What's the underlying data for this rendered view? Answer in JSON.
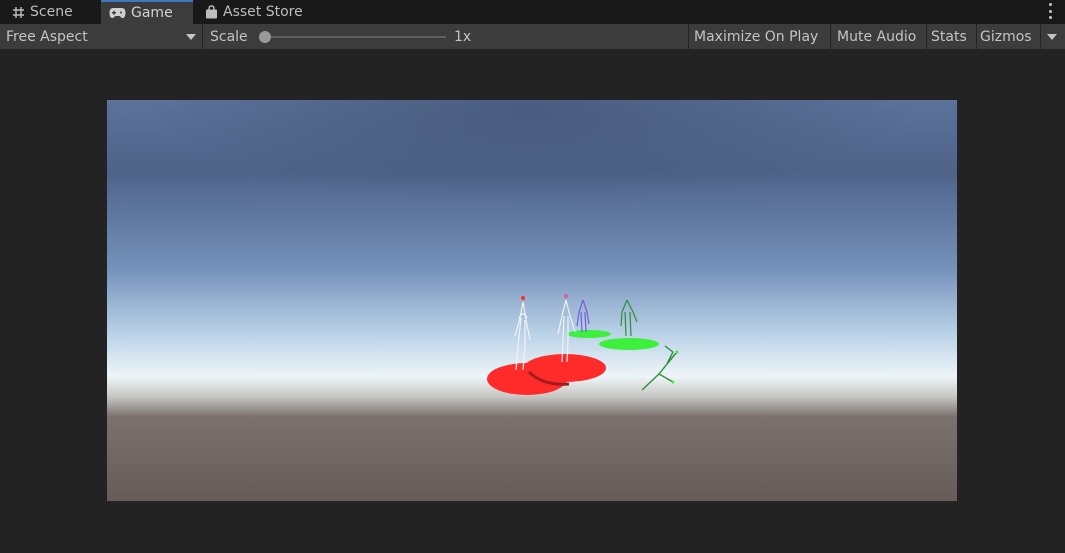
{
  "tabs": [
    {
      "label": "Scene",
      "icon": "grid-icon"
    },
    {
      "label": "Game",
      "icon": "gamepad-icon",
      "active": true
    },
    {
      "label": "Asset Store",
      "icon": "shopping-bag-icon"
    }
  ],
  "toolbar": {
    "aspect_label": "Free Aspect",
    "scale_label": "Scale",
    "scale_value": "1x",
    "scale_level": 0,
    "maximize_label": "Maximize On Play",
    "mute_label": "Mute Audio",
    "stats_label": "Stats",
    "gizmos_label": "Gizmos"
  },
  "colors": {
    "accent": "#3a79bb",
    "sky_top": "#4f6389",
    "horizon": "#e9f1f6",
    "ground": "#6a5f59",
    "red_marker": "#ff2b2b",
    "green_marker": "#3df03d"
  }
}
